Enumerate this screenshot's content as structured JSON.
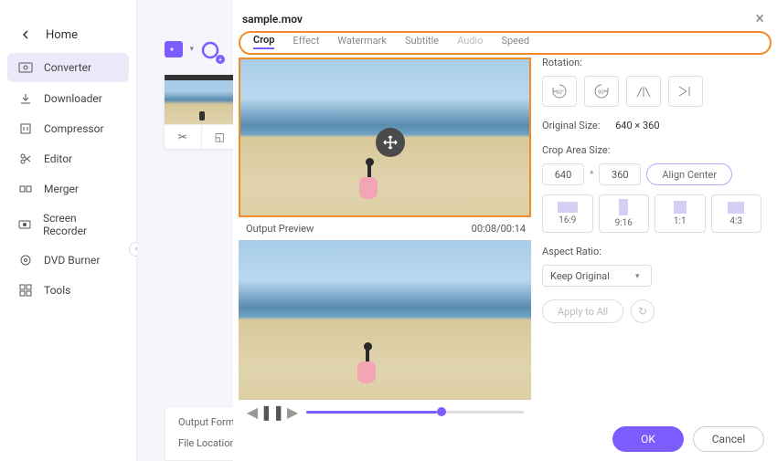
{
  "sidebar": {
    "home": "Home",
    "items": [
      {
        "label": "Converter"
      },
      {
        "label": "Downloader"
      },
      {
        "label": "Compressor"
      },
      {
        "label": "Editor"
      },
      {
        "label": "Merger"
      },
      {
        "label": "Screen Recorder"
      },
      {
        "label": "DVD Burner"
      },
      {
        "label": "Tools"
      }
    ]
  },
  "footer": {
    "output_format": "Output Format:",
    "file_location": "File Location:"
  },
  "modal": {
    "file": "sample.mov",
    "tabs": {
      "crop": "Crop",
      "effect": "Effect",
      "watermark": "Watermark",
      "subtitle": "Subtitle",
      "audio": "Audio",
      "speed": "Speed"
    },
    "output_preview": "Output Preview",
    "timecode": "00:08/00:14",
    "ok": "OK",
    "cancel": "Cancel"
  },
  "settings": {
    "rotation_label": "Rotation:",
    "rot1": "90°",
    "rot2": "90°",
    "original_label": "Original Size:",
    "original_value": "640 × 360",
    "crop_label": "Crop Area Size:",
    "crop_w": "640",
    "crop_h": "360",
    "align": "Align Center",
    "aspects": {
      "a169": "16:9",
      "a916": "9:16",
      "a11": "1:1",
      "a43": "4:3"
    },
    "aspect_label": "Aspect Ratio:",
    "aspect_value": "Keep Original",
    "apply": "Apply to All"
  }
}
